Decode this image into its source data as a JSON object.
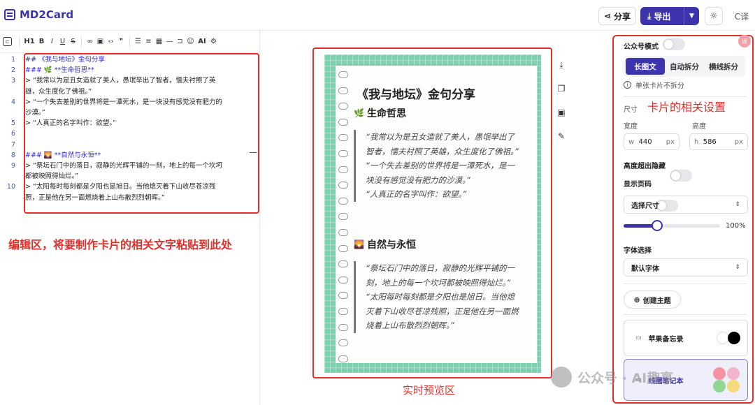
{
  "colors": {
    "accent": "#3d33ad",
    "annotation_red": "#e0302a",
    "card_green": "#7dd1b0"
  },
  "header": {
    "app_name": "MD2Card",
    "share_label": "分享",
    "export_label": "导出",
    "theme_icon": "sun-icon",
    "lang_label": "C译"
  },
  "editor": {
    "toolbar_items": [
      "sidebar-toggle-icon",
      "heading-icon",
      "bold-icon",
      "italic-icon",
      "underline-icon",
      "strikethrough-icon",
      "link-icon",
      "image-icon",
      "code-icon",
      "quote-icon",
      "bullet-list-icon",
      "ordered-list-icon",
      "table-icon",
      "hr-icon",
      "codeblock-icon",
      "emoji-icon",
      "ai-icon",
      "settings-icon"
    ],
    "h1_label": "H1",
    "ai_label": "AI",
    "lines": [
      {
        "num": "1",
        "text": "## 《我与地坛》金句分享",
        "type": "h"
      },
      {
        "num": "2",
        "text": "### 🌿 **生命哲思**",
        "type": "h"
      },
      {
        "num": "3",
        "text": "> “我常以为是丑女造就了美人，愚氓举出了智者，懦夫衬照了英",
        "type": "q"
      },
      {
        "num": "",
        "text": "雄，众生度化了佛祖。”",
        "type": "q"
      },
      {
        "num": "4",
        "text": "> “一个失去差别的世界将是一潭死水，是一块没有感觉没有肥力的",
        "type": "q"
      },
      {
        "num": "",
        "text": "沙漠。”",
        "type": "q"
      },
      {
        "num": "5",
        "text": "> “人真正的名字叫作：欲望。”",
        "type": "q"
      },
      {
        "num": "6",
        "text": "",
        "type": "q"
      },
      {
        "num": "7",
        "text": "",
        "type": "q"
      },
      {
        "num": "8",
        "text": "### 🌄 **自然与永恒**",
        "type": "h"
      },
      {
        "num": "9",
        "text": "> “祭坛石门中的落日，寂静的光辉平铺的一刻，地上的每一个坎坷",
        "type": "q"
      },
      {
        "num": "",
        "text": "都被映照得灿烂。”",
        "type": "q"
      },
      {
        "num": "10",
        "text": "> “太阳每时每刻都是夕阳也是旭日。当他熄灭着下山收尽苍凉残",
        "type": "q"
      },
      {
        "num": "",
        "text": "照，正是他在另一面燃烧着上山布散烈烈朝晖。”",
        "type": "q"
      }
    ],
    "annotation": "编辑区，将要制作卡片的相关文字粘贴到此处"
  },
  "preview": {
    "card_title": "《我与地坛》金句分享",
    "section1_title": "生命哲思",
    "section1_emoji": "🌿",
    "section1_quotes": [
      "“我常以为是丑女造就了美人，愚氓举出了智者，懦夫衬照了英雄，众生度化了佛祖。”",
      "“一个失去差别的世界将是一潭死水，是一块没有感觉没有肥力的沙漠。”",
      "“人真正的名字叫作：欲望。”"
    ],
    "section2_title": "自然与永恒",
    "section2_emoji": "🌄",
    "section2_quotes": [
      "“祭坛石门中的落日，寂静的光辉平铺的一刻，地上的每一个坎坷都被映照得灿烂。”",
      "“太阳每时每刻都是夕阳也是旭日。当他熄灭着下山收尽苍凉残照，正是他在另一面燃烧着上山布散烈烈朝晖。”"
    ],
    "annotation": "实时预览区",
    "side_tools": [
      "download-icon",
      "copy-icon",
      "image-icon",
      "edit-icon"
    ]
  },
  "settings": {
    "wechat_mode_label": "公众号模式",
    "modes": [
      "长图文",
      "自动拆分",
      "横线拆分"
    ],
    "active_mode": "长图文",
    "info_text": "单张卡片不拆分",
    "size_label": "尺寸",
    "annotation": "卡片的相关设置",
    "width_label": "宽度",
    "height_label": "高度",
    "width_prefix": "w",
    "width_value": "440",
    "height_prefix": "h",
    "height_value": "586",
    "unit": "px",
    "overflow_hidden_label": "高度超出隐藏",
    "show_page_label": "显示页码",
    "size_select": "选择尺寸",
    "zoom_label": "100%",
    "zoom_fraction": 0.35,
    "font_label": "字体选择",
    "font_select": "默认字体",
    "create_theme_label": "创建主题",
    "themes": [
      {
        "name": "苹果备忘录"
      },
      {
        "name": "线圈笔记本"
      }
    ]
  },
  "watermark": {
    "text": "公众号 · AI趣享"
  }
}
